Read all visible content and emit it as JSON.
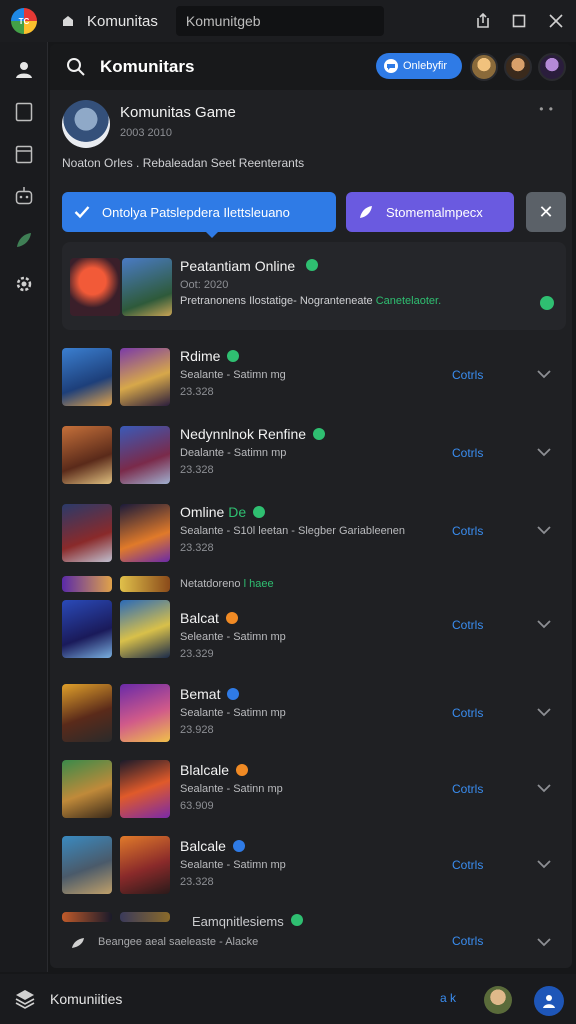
{
  "window": {
    "app_name": "Komunitas",
    "search_value": "Komunitgeb"
  },
  "header": {
    "title": "Komunitars",
    "chip_label": "Onlebyfir"
  },
  "group": {
    "name": "Komunitas Game",
    "meta": "2003 2010",
    "more": "• •",
    "description": "Noaton Orles . Rebaleadan Seet Reenterants"
  },
  "actions": {
    "primary_label": "Ontolya Patslepdera Ilettsleuano",
    "secondary_label": "Stomemalmpecx"
  },
  "featured": {
    "title": "Peatantiam Online",
    "sub": "Oot: 2020",
    "desc_main": "Pretranonens Ilostatige- Nogranteneate",
    "desc_accent": "Canetelaoter."
  },
  "rows": [
    {
      "title": "Rdime",
      "sub": "Sealante - Satimn mg",
      "count": "23.328",
      "link": "Cotrls",
      "badge": "#2fbf71"
    },
    {
      "title": "Nedynnlnok Renfine",
      "sub": "Dealante - Satimn mp",
      "count": "23.328",
      "link": "Cotrls",
      "badge": "#2fbf71"
    },
    {
      "title": "Omline",
      "title_accent": "De",
      "sub": "Sealante - S10l leetan - Slegber Gariableenen",
      "count": "23.328",
      "link": "Cotrls",
      "badge": "#2fbf71"
    },
    {
      "title": "Balcat",
      "sub": "Seleante - Satimn mp",
      "count": "23.329",
      "link": "Cotrls",
      "badge": "#f08a24"
    },
    {
      "title": "Bemat",
      "sub": "Sealante - Satimn mp",
      "count": "23.928",
      "link": "Cotrls",
      "badge": "#2f7be6"
    },
    {
      "title": "Blalcale",
      "sub": "Sealante - Satinn mp",
      "count": "63.909",
      "link": "Cotrls",
      "badge": "#f08a24"
    },
    {
      "title": "Balcale",
      "sub": "Sealante - Satimn mp",
      "count": "23.328",
      "link": "Cotrls",
      "badge": "#2f7be6"
    }
  ],
  "divider": {
    "text": "Netatdoreno",
    "accent": "l haee"
  },
  "fade_row": {
    "title": "Eamqnitlesiems",
    "sub": "Beangee aeal  saeleaste - Alacke",
    "link": "Cotrls"
  },
  "footer": {
    "title": "Komuniities",
    "zoom": "a k"
  }
}
